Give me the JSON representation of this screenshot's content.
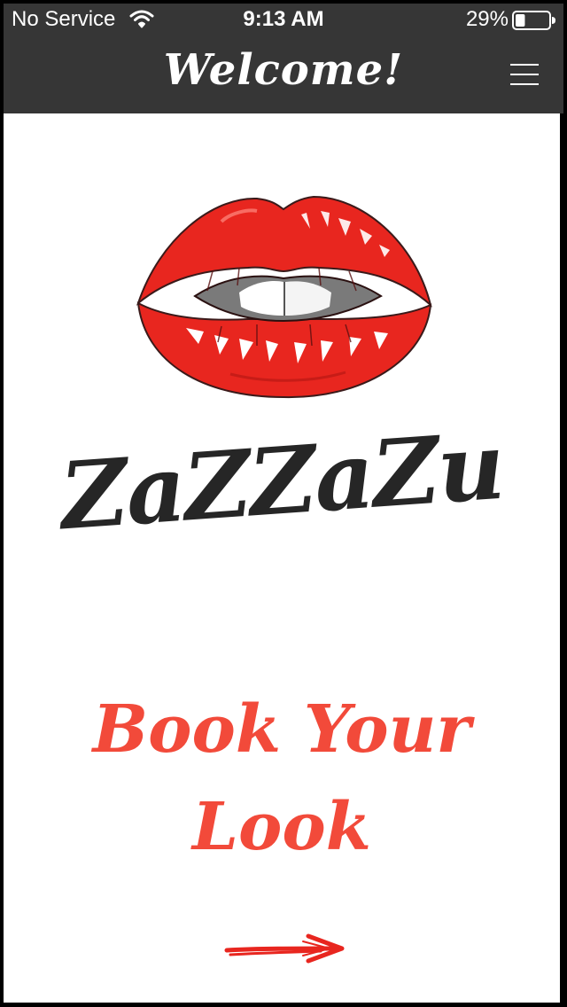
{
  "status_bar": {
    "carrier": "No Service",
    "time": "9:13 AM",
    "battery_percent": "29%",
    "battery_level": 0.29,
    "icons": [
      "wifi-icon",
      "battery-icon"
    ]
  },
  "header": {
    "title": "Welcome!",
    "menu_icon": "hamburger-menu-icon"
  },
  "main": {
    "logo_image": "red-lips-illustration",
    "brand_name": "ZaZZaZu",
    "cta_label": "Book Your Look",
    "next_icon": "arrow-right-icon"
  },
  "colors": {
    "header_bg": "#363636",
    "content_bg": "#ffffff",
    "lips_red": "#e8261f",
    "cta_red": "#f24a3a",
    "brand_text": "#262626"
  }
}
